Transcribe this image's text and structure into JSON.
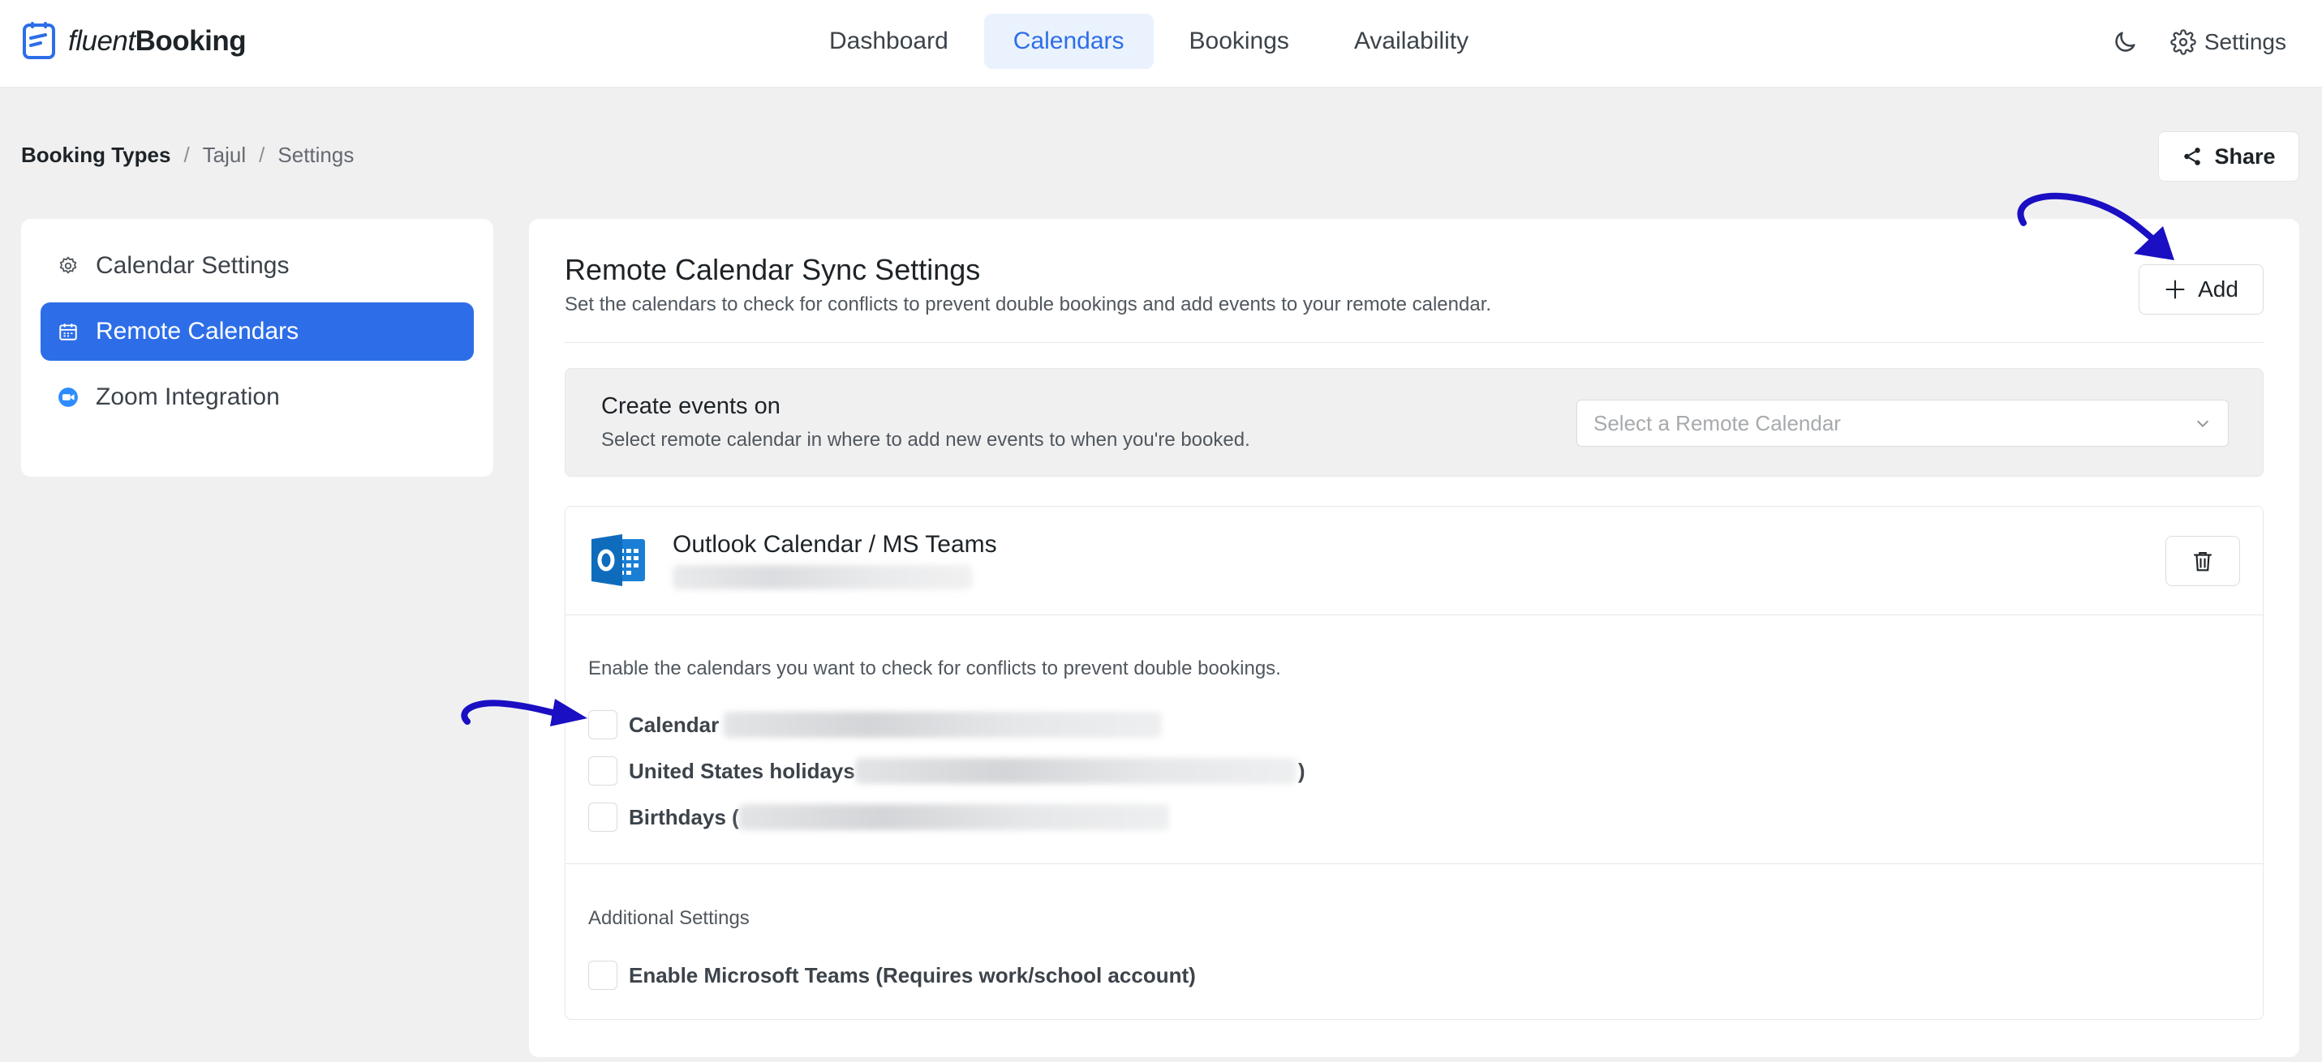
{
  "brand": {
    "name_light": "fluent",
    "name_bold": "Booking"
  },
  "nav": {
    "items": [
      {
        "label": "Dashboard"
      },
      {
        "label": "Calendars"
      },
      {
        "label": "Bookings"
      },
      {
        "label": "Availability"
      }
    ],
    "active": "Calendars"
  },
  "header_right": {
    "settings_label": "Settings"
  },
  "breadcrumb": {
    "root": "Booking Types",
    "sep": "/",
    "host": "Tajul",
    "current": "Settings"
  },
  "share_label": "Share",
  "sidebar": {
    "items": [
      {
        "label": "Calendar Settings",
        "icon": "gear-icon"
      },
      {
        "label": "Remote Calendars",
        "icon": "calendar-icon"
      },
      {
        "label": "Zoom Integration",
        "icon": "zoom-icon"
      }
    ],
    "active": "Remote Calendars"
  },
  "panel": {
    "title": "Remote Calendar Sync Settings",
    "description": "Set the calendars to check for conflicts to prevent double bookings and add events to your remote calendar.",
    "add_label": "Add"
  },
  "create_events": {
    "title": "Create events on",
    "description": "Select remote calendar in where to add new events to when you're booked.",
    "select_placeholder": "Select a Remote Calendar"
  },
  "account": {
    "name": "Outlook Calendar / MS Teams",
    "conflict_text": "Enable the calendars you want to check for conflicts to prevent double bookings.",
    "calendars": [
      {
        "label": "Calendar",
        "suffix": ""
      },
      {
        "label": "United States holidays",
        "suffix": ")"
      },
      {
        "label": "Birthdays (",
        "suffix": ""
      }
    ],
    "additional_settings_title": "Additional Settings",
    "teams_option": "Enable Microsoft Teams (Requires work/school account)"
  },
  "colors": {
    "accent": "#2d6ee8",
    "annotation_arrow": "#1a0fc2",
    "outlook": "#0f6cbd"
  }
}
